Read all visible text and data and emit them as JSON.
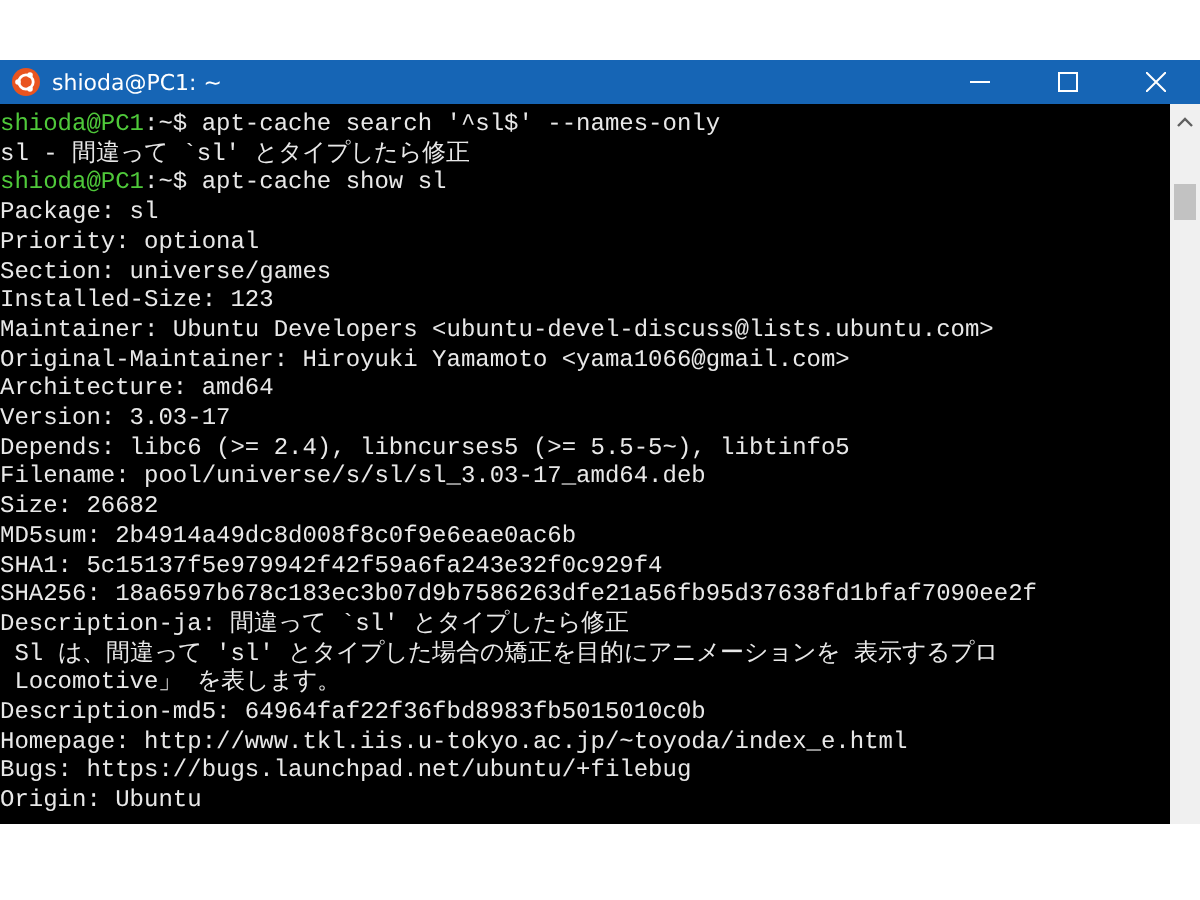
{
  "window": {
    "title": "shioda@PC1: ~"
  },
  "terminal": {
    "lines": [
      {
        "kind": "prompt",
        "user": "shioda@PC1",
        "text": ":~$ apt-cache search '^sl$' --names-only"
      },
      {
        "kind": "output",
        "text": "sl - 間違って `sl' とタイプしたら修正"
      },
      {
        "kind": "prompt",
        "user": "shioda@PC1",
        "text": ":~$ apt-cache show sl"
      },
      {
        "kind": "output",
        "text": "Package: sl"
      },
      {
        "kind": "output",
        "text": "Priority: optional"
      },
      {
        "kind": "output",
        "text": "Section: universe/games"
      },
      {
        "kind": "output",
        "text": "Installed-Size: 123"
      },
      {
        "kind": "output",
        "text": "Maintainer: Ubuntu Developers <ubuntu-devel-discuss@lists.ubuntu.com>"
      },
      {
        "kind": "output",
        "text": "Original-Maintainer: Hiroyuki Yamamoto <yama1066@gmail.com>"
      },
      {
        "kind": "output",
        "text": "Architecture: amd64"
      },
      {
        "kind": "output",
        "text": "Version: 3.03-17"
      },
      {
        "kind": "output",
        "text": "Depends: libc6 (>= 2.4), libncurses5 (>= 5.5-5~), libtinfo5"
      },
      {
        "kind": "output",
        "text": "Filename: pool/universe/s/sl/sl_3.03-17_amd64.deb"
      },
      {
        "kind": "output",
        "text": "Size: 26682"
      },
      {
        "kind": "output",
        "text": "MD5sum: 2b4914a49dc8d008f8c0f9e6eae0ac6b"
      },
      {
        "kind": "output",
        "text": "SHA1: 5c15137f5e979942f42f59a6fa243e32f0c929f4"
      },
      {
        "kind": "output",
        "text": "SHA256: 18a6597b678c183ec3b07d9b7586263dfe21a56fb95d37638fd1bfaf7090ee2f"
      },
      {
        "kind": "output",
        "text": "Description-ja: 間違って `sl' とタイプしたら修正"
      },
      {
        "kind": "output",
        "text": " Sl は、間違って 'sl' とタイプした場合の矯正を目的にアニメーションを 表示するプロ"
      },
      {
        "kind": "output",
        "text": " Locomotive」 を表します。"
      },
      {
        "kind": "output",
        "text": "Description-md5: 64964faf22f36fbd8983fb5015010c0b"
      },
      {
        "kind": "output",
        "text": "Homepage: http://www.tkl.iis.u-tokyo.ac.jp/~toyoda/index_e.html"
      },
      {
        "kind": "output",
        "text": "Bugs: https://bugs.launchpad.net/ubuntu/+filebug"
      },
      {
        "kind": "output",
        "text": "Origin: Ubuntu"
      }
    ]
  }
}
